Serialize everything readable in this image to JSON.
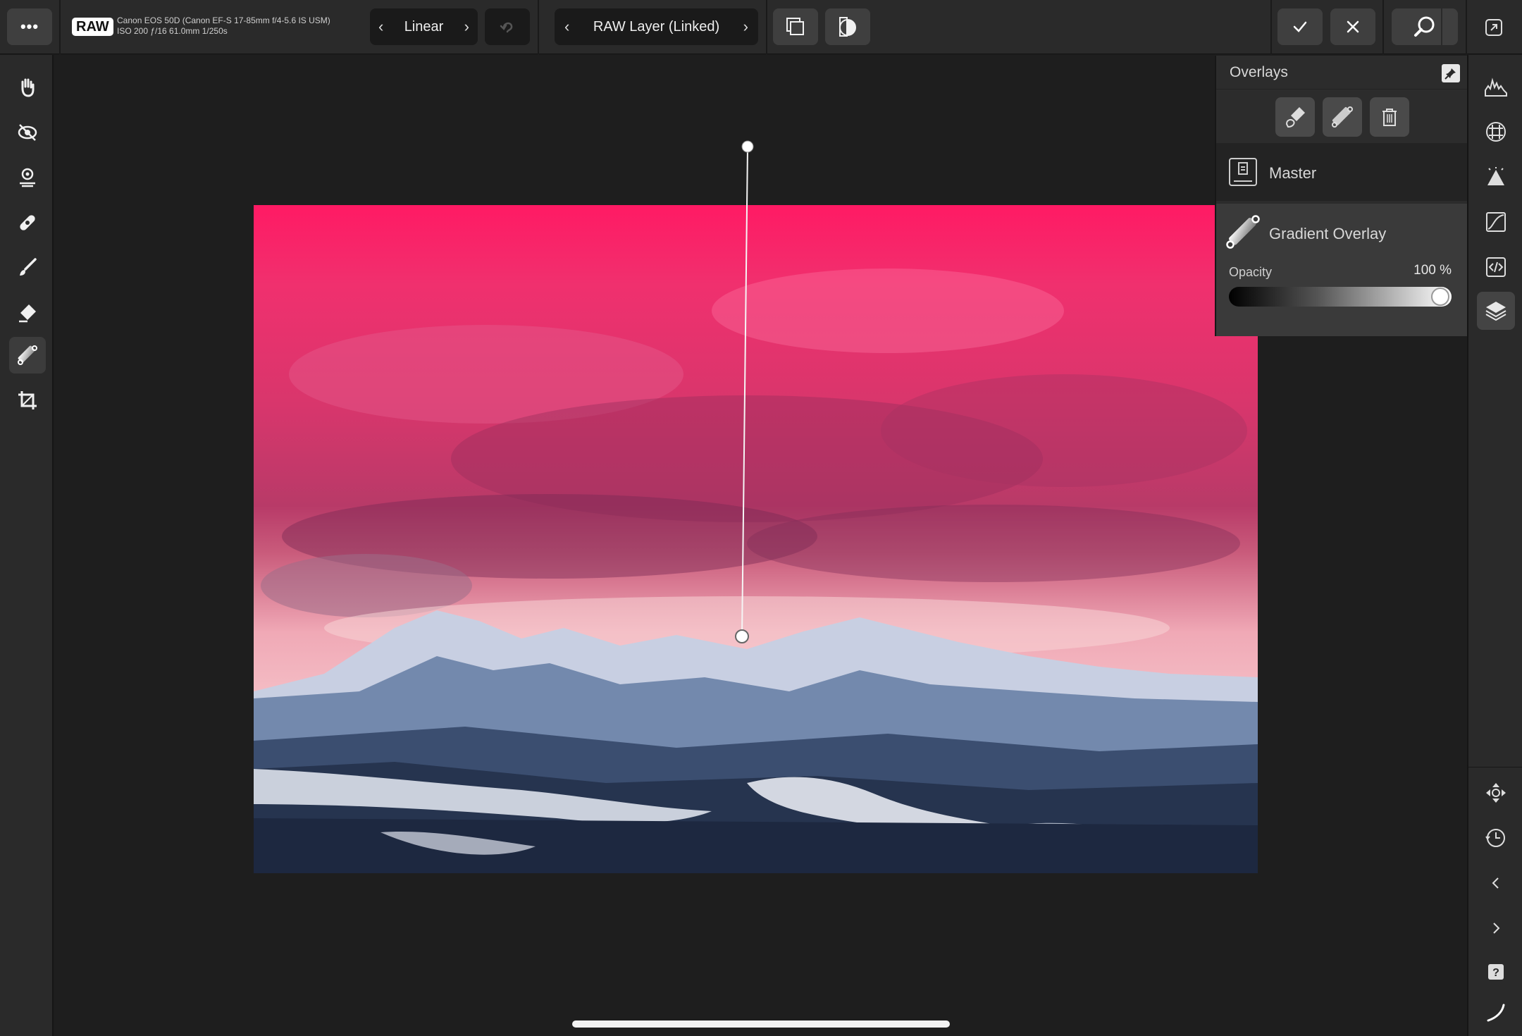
{
  "topbar": {
    "more_label": "•••",
    "raw_badge": "RAW",
    "camera_line1": "Canon EOS 50D (Canon EF-S 17-85mm f/4-5.6 IS USM)",
    "camera_line2": "ISO 200 ƒ/16 61.0mm 1/250s",
    "mode_label": "Linear",
    "layer_label": "RAW Layer (Linked)"
  },
  "panel": {
    "title": "Overlays",
    "layers": [
      {
        "label": "Master"
      },
      {
        "label": "Gradient Overlay"
      }
    ],
    "opacity_label": "Opacity",
    "opacity_value": "100 %",
    "opacity_level": 1.0
  },
  "colors": {
    "accent": "#ff1a64",
    "panel_bg": "#2c2c2c",
    "toolbar_bg": "#2a2a2a"
  }
}
